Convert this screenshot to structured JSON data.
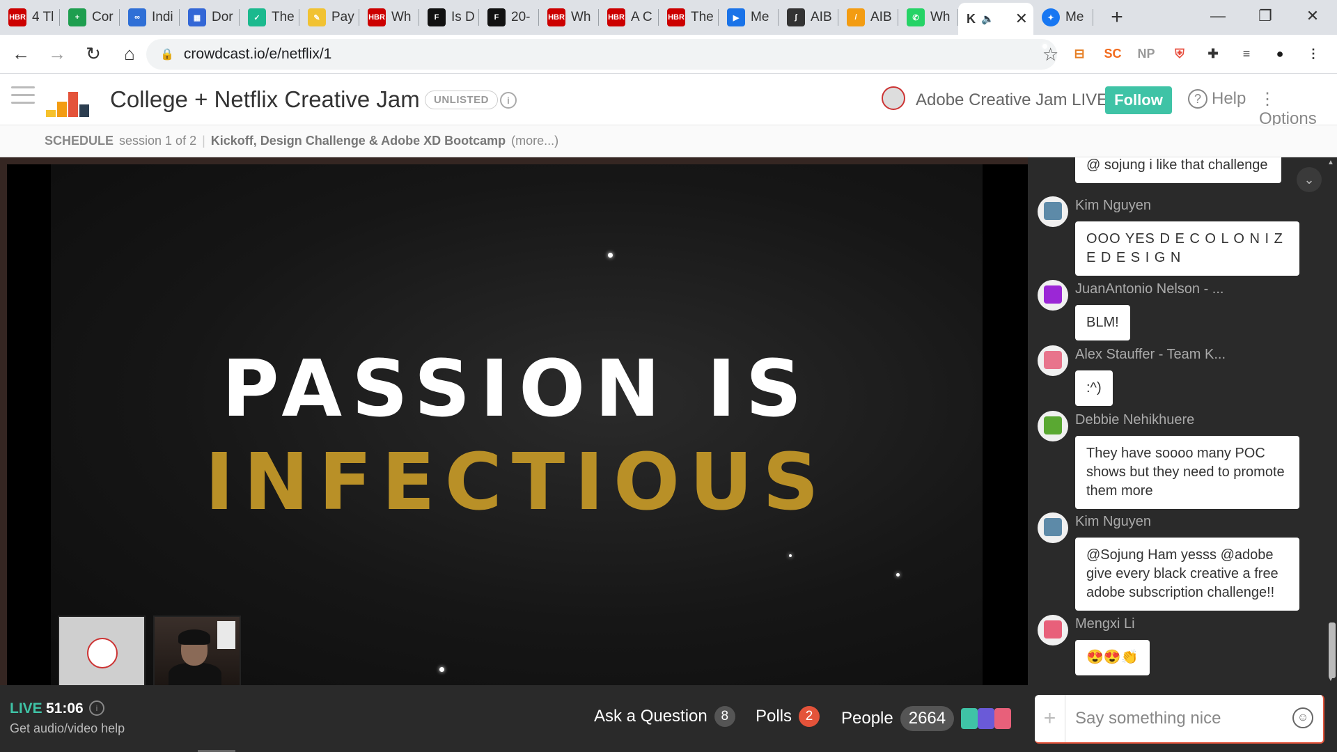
{
  "browser": {
    "tabs": [
      {
        "icon": "hbr-icon",
        "color": "#c00",
        "short": "HBR",
        "label": "4 Tl"
      },
      {
        "icon": "sheets-icon",
        "color": "#1e9e4f",
        "short": "+",
        "label": "Cor"
      },
      {
        "icon": "infinity-icon",
        "color": "#2f6fd6",
        "short": "∞",
        "label": "Indi"
      },
      {
        "icon": "apps-grid-icon",
        "color": "#3367d6",
        "short": "▦",
        "label": "Dor"
      },
      {
        "icon": "shield-check-icon",
        "color": "#1bb98e",
        "short": "✓",
        "label": "The"
      },
      {
        "icon": "pay-icon",
        "color": "#f1c232",
        "short": "✎",
        "label": "Pay"
      },
      {
        "icon": "hbr-icon",
        "color": "#c00",
        "short": "HBR",
        "label": "Wh"
      },
      {
        "icon": "forbes-icon",
        "color": "#111",
        "short": "F",
        "label": "Is D"
      },
      {
        "icon": "forbes-icon",
        "color": "#111",
        "short": "F",
        "label": "20-"
      },
      {
        "icon": "hbr-icon",
        "color": "#c00",
        "short": "HBR",
        "label": "Wh"
      },
      {
        "icon": "hbr-icon",
        "color": "#c00",
        "short": "HBR",
        "label": "A C"
      },
      {
        "icon": "hbr-icon",
        "color": "#c00",
        "short": "HBR",
        "label": "The"
      },
      {
        "icon": "play-icon",
        "color": "#1a73e8",
        "short": "▶",
        "label": "Me"
      },
      {
        "icon": "script-icon",
        "color": "#333",
        "short": "ʃ",
        "label": "AIB"
      },
      {
        "icon": "notepad-icon",
        "color": "#f39c12",
        "short": "/",
        "label": "AIB"
      },
      {
        "icon": "whatsapp-icon",
        "color": "#25d366",
        "short": "✆",
        "label": "Wh"
      }
    ],
    "active_tab": {
      "label": "K",
      "speaker": "🔈",
      "close": "✕"
    },
    "messenger_tab": {
      "label": "Me"
    },
    "new_tab": "+",
    "window": {
      "minimize": "—",
      "restore": "❐",
      "close": "✕"
    },
    "nav": {
      "back": "←",
      "forward": "→",
      "reload": "↻",
      "home": "⌂"
    },
    "url": "crowdcast.io/e/netflix/1",
    "bookmark_star": "☆",
    "extensions": [
      {
        "name": "layout-icon",
        "color": "#e67e22",
        "glyph": "⊟"
      },
      {
        "name": "sc-icon",
        "color": "#f26b1d",
        "glyph": "SC"
      },
      {
        "name": "np-icon",
        "color": "#999",
        "glyph": "NP"
      },
      {
        "name": "shield-icon",
        "color": "#e74c3c",
        "glyph": "⛨"
      },
      {
        "name": "puzzle-icon",
        "color": "#333",
        "glyph": "✚"
      },
      {
        "name": "playlist-icon",
        "color": "#333",
        "glyph": "≡"
      },
      {
        "name": "profile-avatar",
        "color": "#1a1a1a",
        "glyph": "●"
      },
      {
        "name": "kebab-menu-icon",
        "color": "#333",
        "glyph": "⋮"
      }
    ]
  },
  "header": {
    "title": "College + Netflix Creative Jam",
    "badge": "UNLISTED",
    "info": "i",
    "host": "Adobe Creative Jam LIVE",
    "follow": "Follow",
    "help": "Help",
    "help_glyph": "?",
    "options": "Options",
    "options_glyph": "⋮",
    "accent": "#3fc3a6"
  },
  "schedule": {
    "label": "SCHEDULE",
    "session": "session 1 of 2",
    "separator": "|",
    "title": "Kickoff, Design Challenge & Adobe XD Bootcamp",
    "more": "(more...)"
  },
  "stage": {
    "line1": "PASSION IS",
    "line2": "INFECTIOUS",
    "gold": "#b99027"
  },
  "bottom": {
    "live": "LIVE",
    "time": "51:06",
    "info": "i",
    "av_help": "Get audio/video help",
    "ask": "Ask a Question",
    "ask_count": "8",
    "polls": "Polls",
    "polls_count": "2",
    "people": "People",
    "people_count": "2664"
  },
  "chat": {
    "collapse": "⌄",
    "messages": [
      {
        "name": "",
        "text": "@ sojung i like that challenge",
        "avatar_color": "#c0392b"
      },
      {
        "name": "Kim Nguyen",
        "text": "OOO YES D E C O L O N I Z E D E S I G N",
        "avatar_color": "#5d8aa8"
      },
      {
        "name": "JuanAntonio Nelson - ...",
        "text": "BLM!",
        "avatar_color": "#9b27d6"
      },
      {
        "name": "Alex Stauffer - Team K...",
        "text": ":^)",
        "avatar_color": "#e8748c"
      },
      {
        "name": "Debbie Nehikhuere",
        "text": "They have soooo many POC shows but they need to promote them more",
        "avatar_color": "#5aa832"
      },
      {
        "name": "Kim Nguyen",
        "text": "@Sojung Ham yesss @adobe give every black creative a free adobe subscription challenge!!",
        "avatar_color": "#5d8aa8"
      },
      {
        "name": "Mengxi Li",
        "text": "😍😍👏",
        "avatar_color": "#e8607a"
      }
    ],
    "input_placeholder": "Say something nice",
    "plus": "+",
    "emoji": "☺"
  }
}
